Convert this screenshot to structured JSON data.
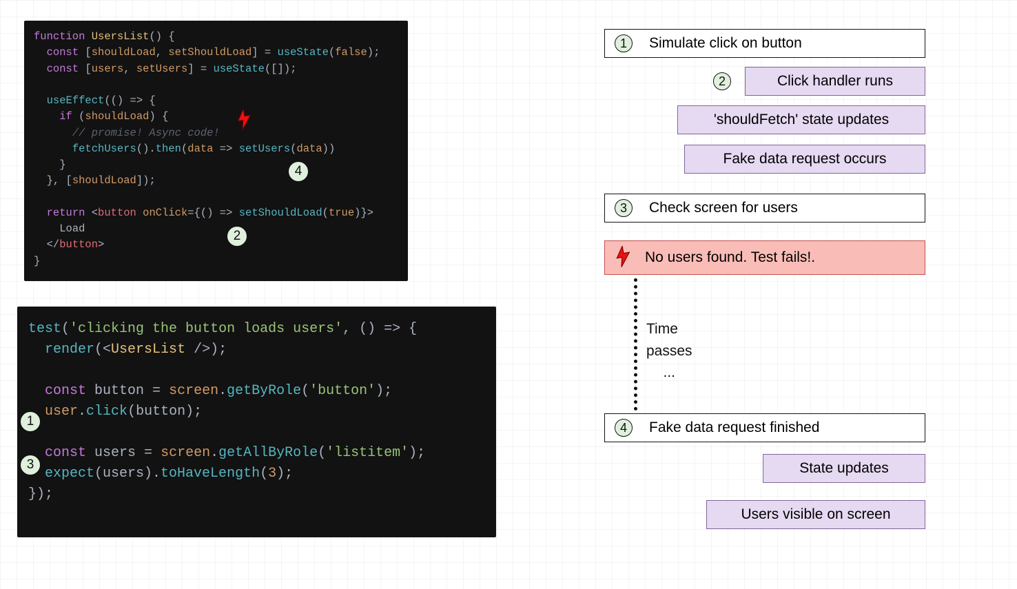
{
  "code1": {
    "lines": {
      "l1a": "function",
      "l1b": "UsersList",
      "l1c": "() {",
      "l2a": "const",
      "l2b": "[",
      "l2c": "shouldLoad",
      "l2d": ", ",
      "l2e": "setShouldLoad",
      "l2f": "] = ",
      "l2g": "useState",
      "l2h": "(",
      "l2i": "false",
      "l2j": ");",
      "l3a": "const",
      "l3b": "[",
      "l3c": "users",
      "l3d": ", ",
      "l3e": "setUsers",
      "l3f": "] = ",
      "l3g": "useState",
      "l3h": "([]);",
      "l4a": "useEffect",
      "l4b": "(() => {",
      "l5a": "if",
      "l5b": "(",
      "l5c": "shouldLoad",
      "l5d": ") {",
      "l6": "// promise! Async code!",
      "l7a": "fetchUsers",
      "l7b": "().",
      "l7c": "then",
      "l7d": "(",
      "l7e": "data",
      "l7f": " => ",
      "l7g": "setUsers",
      "l7h": "(",
      "l7i": "data",
      "l7j": "))",
      "l8": "}",
      "l9a": "}, [",
      "l9b": "shouldLoad",
      "l9c": "]);",
      "l10a": "return",
      "l10b": "<",
      "l10c": "button",
      "l10d": "onClick",
      "l10e": "={() => ",
      "l10f": "setShouldLoad",
      "l10g": "(",
      "l10h": "true",
      "l10i": ")}>",
      "l11": "Load",
      "l12a": "</",
      "l12b": "button",
      "l12c": ">",
      "l13": "}"
    }
  },
  "code2": {
    "lines": {
      "l1a": "test",
      "l1b": "(",
      "l1c": "'clicking the button loads users'",
      "l1d": ", () => {",
      "l2a": "render",
      "l2b": "(<",
      "l2c": "UsersList",
      "l2d": " />);",
      "l3a": "const",
      "l3b": " button = ",
      "l3c": "screen",
      "l3d": ".",
      "l3e": "getByRole",
      "l3f": "(",
      "l3g": "'button'",
      "l3h": ");",
      "l4a": "user",
      "l4b": ".",
      "l4c": "click",
      "l4d": "(button);",
      "l5a": "const",
      "l5b": " users = ",
      "l5c": "screen",
      "l5d": ".",
      "l5e": "getAllByRole",
      "l5f": "(",
      "l5g": "'listitem'",
      "l5h": ");",
      "l6a": "expect",
      "l6b": "(users).",
      "l6c": "toHaveLength",
      "l6d": "(",
      "l6e": "3",
      "l6f": ");",
      "l7": "});"
    }
  },
  "steps": {
    "s1": {
      "num": "1",
      "text": "Simulate click on button"
    },
    "s2": {
      "num": "2",
      "text": "Click handler runs"
    },
    "p1": {
      "text": "'shouldFetch' state updates"
    },
    "p2": {
      "text": "Fake data request occurs"
    },
    "s3": {
      "num": "3",
      "text": "Check screen for users"
    },
    "err": {
      "text": "No users found. Test fails!."
    },
    "time": {
      "l1": "Time",
      "l2": "passes",
      "l3": "..."
    },
    "s4": {
      "num": "4",
      "text": "Fake data request finished"
    },
    "p3": {
      "text": "State updates"
    },
    "p4": {
      "text": "Users visible on screen"
    }
  },
  "badges": {
    "code1_b4": "4",
    "code1_b2": "2",
    "code2_b1": "1",
    "code2_b3": "3"
  }
}
